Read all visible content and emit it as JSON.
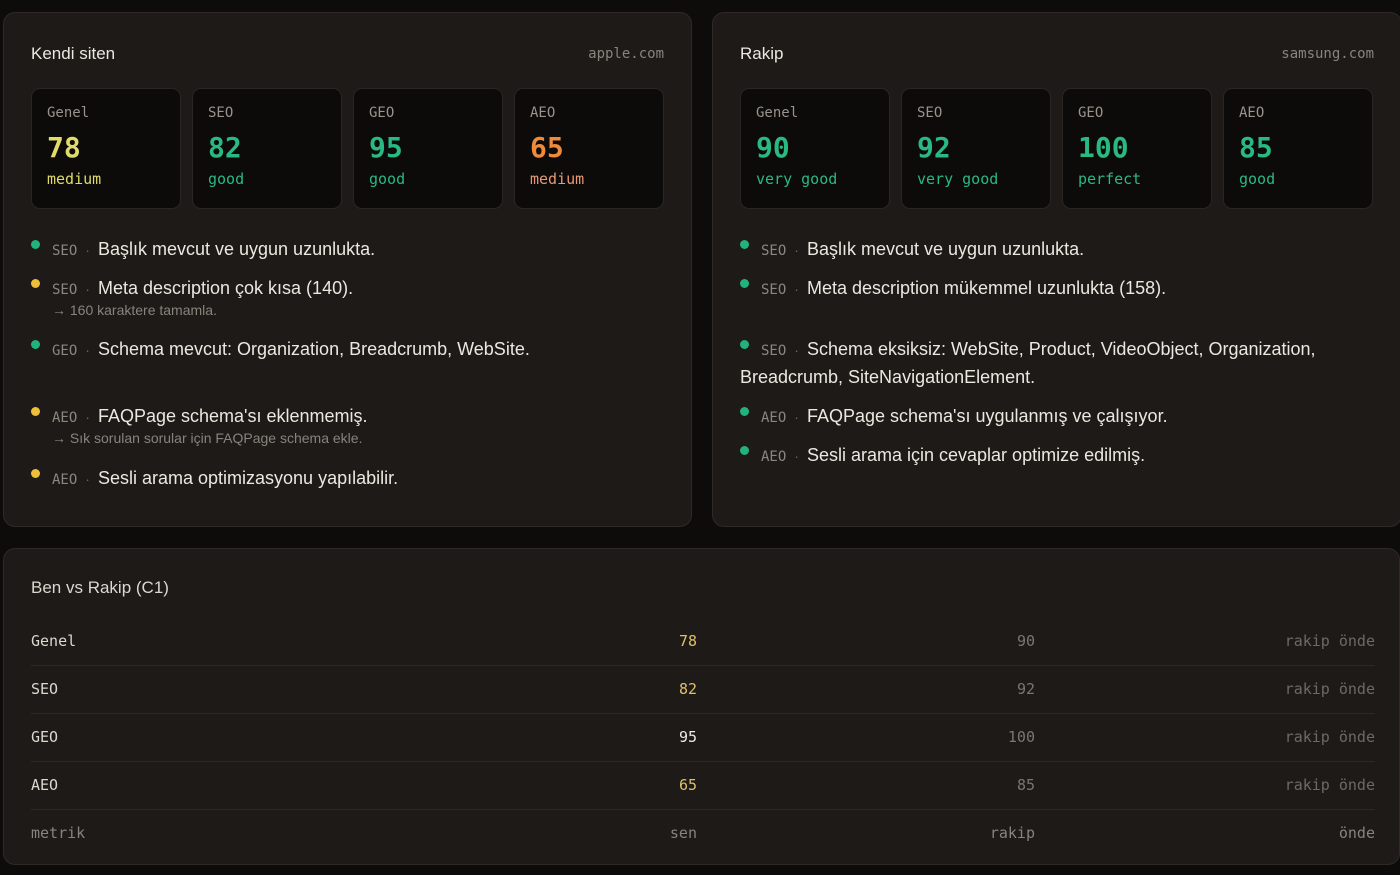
{
  "own": {
    "title": "Kendi siten",
    "domain": "apple.com",
    "scores": [
      {
        "label": "Genel",
        "score": "78",
        "grade": "medium"
      },
      {
        "label": "SEO",
        "score": "82",
        "grade": "good"
      },
      {
        "label": "GEO",
        "score": "95",
        "grade": "good"
      },
      {
        "label": "AEO",
        "score": "65",
        "grade": "medium"
      }
    ],
    "items": [
      {
        "tag": "SEO",
        "text": "Başlık mevcut ve uygun uzunlukta.",
        "status": "green"
      },
      {
        "tag": "SEO",
        "text": "Meta description çok kısa (140).",
        "hint": "→ 160 karaktere tamamla.",
        "status": "yellow"
      },
      {
        "tag": "GEO",
        "text": "Schema mevcut: Organization, Breadcrumb, WebSite.",
        "status": "green"
      },
      {
        "tag": "AEO",
        "text": "FAQPage schema'sı eklenmemiş.",
        "hint": "→ Sık sorulan sorular için FAQPage schema ekle.",
        "status": "yellow"
      },
      {
        "tag": "AEO",
        "text": "Sesli arama optimizasyonu yapılabilir.",
        "status": "yellow"
      }
    ]
  },
  "rival": {
    "title": "Rakip",
    "domain": "samsung.com",
    "scores": [
      {
        "label": "Genel",
        "score": "90",
        "grade": "very good"
      },
      {
        "label": "SEO",
        "score": "92",
        "grade": "very good"
      },
      {
        "label": "GEO",
        "score": "100",
        "grade": "perfect"
      },
      {
        "label": "AEO",
        "score": "85",
        "grade": "good"
      }
    ],
    "items": [
      {
        "tag": "SEO",
        "text": "Başlık mevcut ve uygun uzunlukta.",
        "status": "green"
      },
      {
        "tag": "SEO",
        "text": "Meta description mükemmel uzunlukta (158).",
        "status": "green"
      },
      {
        "tag": "SEO",
        "text": "Schema eksiksiz: WebSite, Product, VideoObject, Organization,",
        "text2": "Breadcrumb, SiteNavigationElement.",
        "status": "green"
      },
      {
        "tag": "AEO",
        "text": "FAQPage schema'sı uygulanmış ve çalışıyor.",
        "status": "green"
      },
      {
        "tag": "AEO",
        "text": "Sesli arama için cevaplar optimize edilmiş.",
        "status": "green"
      }
    ]
  },
  "compare": {
    "title": "Ben vs Rakip (C1)",
    "rows": [
      {
        "metric": "Genel",
        "me": "78",
        "rival": "90",
        "ahead": "rakip önde"
      },
      {
        "metric": "SEO",
        "me": "82",
        "rival": "92",
        "ahead": "rakip önde"
      },
      {
        "metric": "GEO",
        "me": "95",
        "rival": "100",
        "ahead": "rakip önde"
      },
      {
        "metric": "AEO",
        "me": "65",
        "rival": "85",
        "ahead": "rakip önde"
      }
    ],
    "footer": {
      "metric": "metrik",
      "me": "sen",
      "rival": "rakip",
      "ahead": "önde"
    }
  },
  "colors": {
    "medium_yellow": "#e0db6a",
    "good_green": "#29b982",
    "medium_orange": "#ee8a3a",
    "dot_green": "#22b37a",
    "dot_yellow": "#f0bf3a"
  }
}
